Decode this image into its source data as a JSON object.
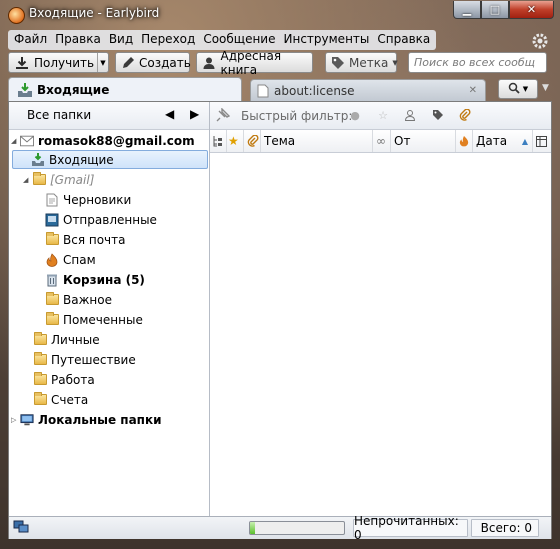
{
  "window": {
    "title": "Входящие - Earlybird"
  },
  "menu": [
    "Файл",
    "Правка",
    "Вид",
    "Переход",
    "Сообщение",
    "Инструменты",
    "Справка"
  ],
  "toolbar": {
    "get_mail": "Получить",
    "write": "Создать",
    "address_book": "Адресная книга",
    "tag": "Метка",
    "search_placeholder": "Поиск во всех сообщ"
  },
  "tabs": [
    {
      "label": "Входящие",
      "active": true
    },
    {
      "label": "about:license",
      "active": false
    }
  ],
  "folder_pane": {
    "header": "Все папки",
    "account": "romasok88@gmail.com",
    "inbox": "Входящие",
    "gmail_group": "[Gmail]",
    "gmail_folders": [
      "Черновики",
      "Отправленные",
      "Вся почта",
      "Спам",
      "Корзина (5)",
      "Важное",
      "Помеченные"
    ],
    "labels": [
      "Личные",
      "Путешествие",
      "Работа",
      "Счета"
    ],
    "local_folders": "Локальные папки"
  },
  "thread_pane": {
    "quick_filter": "Быстрый фильтр:",
    "columns": {
      "subject": "Тема",
      "from": "От",
      "date": "Дата"
    }
  },
  "statusbar": {
    "progress": 0.05,
    "unread": "Непрочитанных: 0",
    "total": "Всего: 0"
  },
  "colors": {
    "selection": "#cfe3fa",
    "folder": "#e8b848",
    "accent": "#3c7fc0"
  }
}
